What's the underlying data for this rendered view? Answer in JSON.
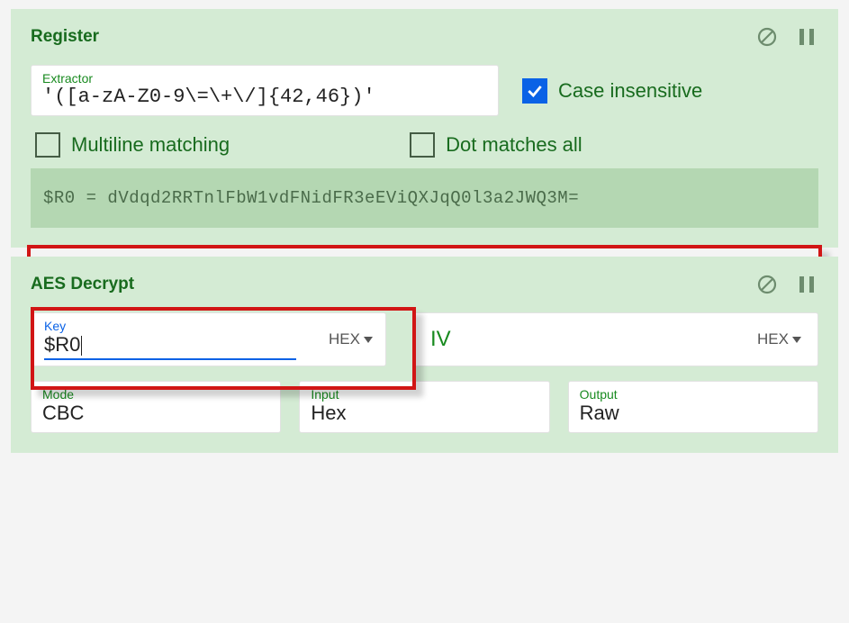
{
  "register": {
    "title": "Register",
    "extractor_label": "Extractor",
    "extractor_value": "'([a-zA-Z0-9\\=\\+\\/]{42,46})'",
    "case_insensitive_label": "Case insensitive",
    "case_insensitive_checked": true,
    "multiline_label": "Multiline matching",
    "multiline_checked": false,
    "dotall_label": "Dot matches all",
    "dotall_checked": false,
    "output": "$R0 = dVdqd2RRTnlFbW1vdFNidFR3eEViQXJqQ0l3a2JWQ3M="
  },
  "aes": {
    "title": "AES Decrypt",
    "key_label": "Key",
    "key_value": "$R0",
    "key_format": "HEX",
    "iv_label": "IV",
    "iv_format": "HEX",
    "mode_label": "Mode",
    "mode_value": "CBC",
    "input_label": "Input",
    "input_value": "Hex",
    "output_label": "Output",
    "output_value": "Raw"
  }
}
